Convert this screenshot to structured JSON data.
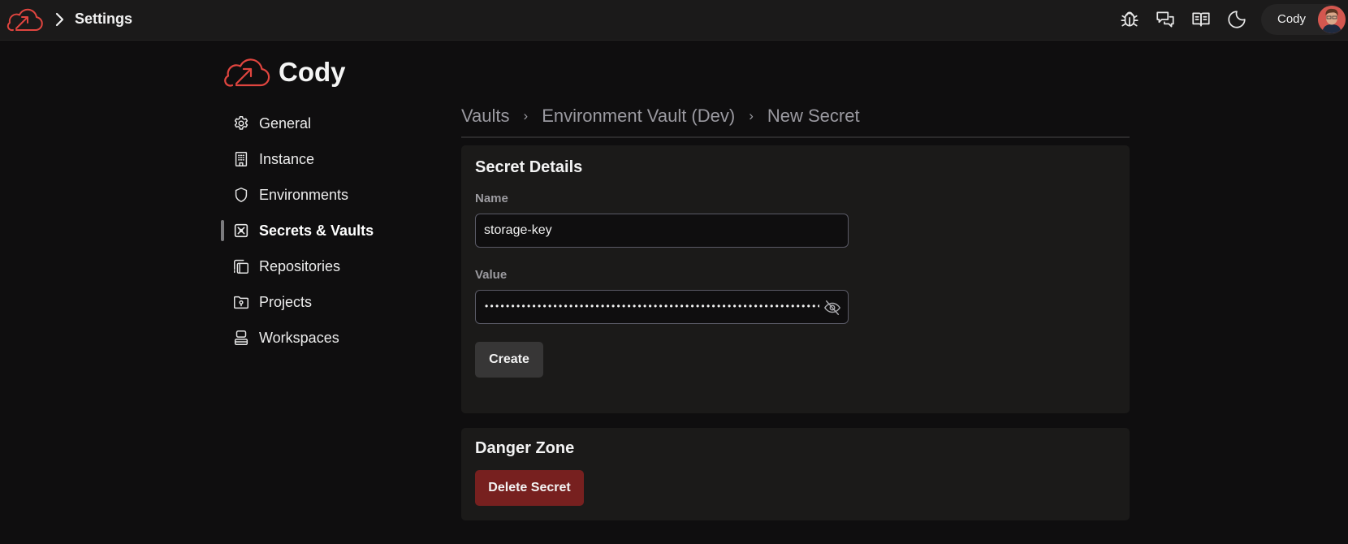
{
  "topbar": {
    "title": "Settings",
    "icons": [
      "bug-icon",
      "chat-icon",
      "book-icon",
      "moon-icon"
    ],
    "user_name": "Cody"
  },
  "sidebar": {
    "brand": "Cody",
    "items": [
      {
        "label": "General",
        "icon": "gear-icon",
        "active": false
      },
      {
        "label": "Instance",
        "icon": "building-icon",
        "active": false
      },
      {
        "label": "Environments",
        "icon": "shield-icon",
        "active": false
      },
      {
        "label": "Secrets & Vaults",
        "icon": "vault-icon",
        "active": true
      },
      {
        "label": "Repositories",
        "icon": "repositories-icon",
        "active": false
      },
      {
        "label": "Projects",
        "icon": "folder-icon",
        "active": false
      },
      {
        "label": "Workspaces",
        "icon": "workspaces-icon",
        "active": false
      }
    ]
  },
  "breadcrumb": [
    "Vaults",
    "Environment Vault (Dev)",
    "New Secret"
  ],
  "details": {
    "title": "Secret Details",
    "name_label": "Name",
    "name_value": "storage-key",
    "value_label": "Value",
    "value_masked": "••••••••••••••••••••••••••••••••••••••••••••••••••••••••••••••••••••••",
    "create_label": "Create"
  },
  "danger": {
    "title": "Danger Zone",
    "delete_label": "Delete Secret"
  },
  "colors": {
    "accent_red": "#e0453f",
    "danger_button": "#77201f"
  }
}
